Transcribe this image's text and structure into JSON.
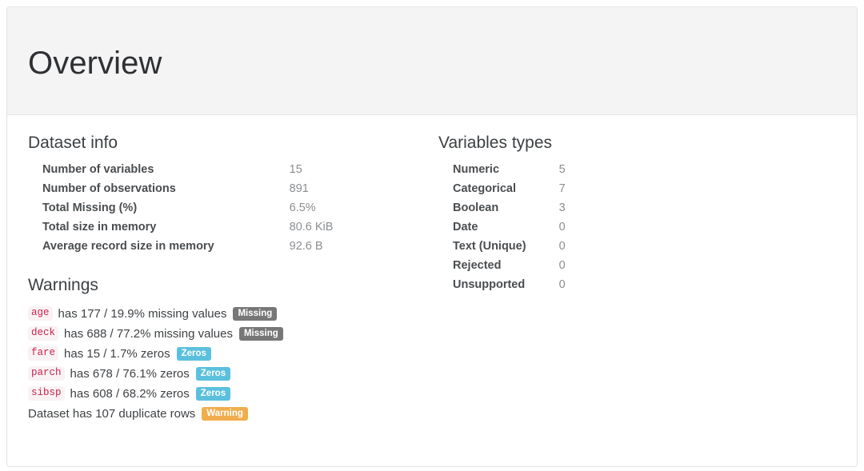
{
  "panel": {
    "title": "Overview"
  },
  "dataset_info": {
    "heading": "Dataset info",
    "rows": [
      {
        "label": "Number of variables",
        "value": "15"
      },
      {
        "label": "Number of observations",
        "value": "891"
      },
      {
        "label": "Total Missing (%)",
        "value": "6.5%"
      },
      {
        "label": "Total size in memory",
        "value": "80.6 KiB"
      },
      {
        "label": "Average record size in memory",
        "value": "92.6 B"
      }
    ]
  },
  "variables_types": {
    "heading": "Variables types",
    "rows": [
      {
        "label": "Numeric",
        "value": "5"
      },
      {
        "label": "Categorical",
        "value": "7"
      },
      {
        "label": "Boolean",
        "value": "3"
      },
      {
        "label": "Date",
        "value": "0"
      },
      {
        "label": "Text (Unique)",
        "value": "0"
      },
      {
        "label": "Rejected",
        "value": "0"
      },
      {
        "label": "Unsupported",
        "value": "0"
      }
    ]
  },
  "warnings": {
    "heading": "Warnings",
    "items": [
      {
        "code": "age",
        "text": "has 177 / 19.9% missing values",
        "badge": "Missing",
        "badge_style": "gray"
      },
      {
        "code": "deck",
        "text": "has 688 / 77.2% missing values",
        "badge": "Missing",
        "badge_style": "gray"
      },
      {
        "code": "fare",
        "text": "has 15 / 1.7% zeros",
        "badge": "Zeros",
        "badge_style": "info"
      },
      {
        "code": "parch",
        "text": "has 678 / 76.1% zeros",
        "badge": "Zeros",
        "badge_style": "info"
      },
      {
        "code": "sibsp",
        "text": "has 608 / 68.2% zeros",
        "badge": "Zeros",
        "badge_style": "info"
      },
      {
        "code": "",
        "text": "Dataset has 107 duplicate rows",
        "badge": "Warning",
        "badge_style": "warning"
      }
    ]
  },
  "colors": {
    "badge_gray": "#777777",
    "badge_info": "#5bc0de",
    "badge_warning": "#f0ad4e",
    "code_text": "#c7254e",
    "code_bg": "#f9f2f4",
    "panel_heading_bg": "#f4f4f5",
    "panel_border": "#e3e3e6"
  }
}
